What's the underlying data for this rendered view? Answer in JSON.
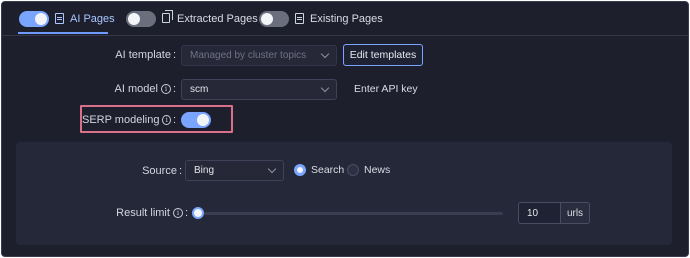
{
  "tabs": [
    {
      "label": "AI Pages",
      "enabled": true,
      "icon": "document-icon"
    },
    {
      "label": "Extracted Pages",
      "enabled": false,
      "icon": "copy-icon"
    },
    {
      "label": "Existing Pages",
      "enabled": false,
      "icon": "document-icon"
    }
  ],
  "ai_template": {
    "label": "AI template",
    "value": "Managed by cluster topics",
    "disabled": true,
    "edit_button": "Edit templates"
  },
  "ai_model": {
    "label": "AI model",
    "value": "scm",
    "api_key_link": "Enter API key"
  },
  "serp_modeling": {
    "label": "SERP modeling",
    "enabled": true
  },
  "source": {
    "label": "Source",
    "value": "Bing",
    "options": [
      "Search",
      "News"
    ],
    "selected": "Search"
  },
  "result_limit": {
    "label": "Result limit",
    "value": "10",
    "unit": "urls",
    "slider_fraction": 0.0
  },
  "colors": {
    "accent": "#7aa5ff",
    "background": "#1d1f2d",
    "panel": "#252838",
    "highlight": "#d9708a"
  }
}
